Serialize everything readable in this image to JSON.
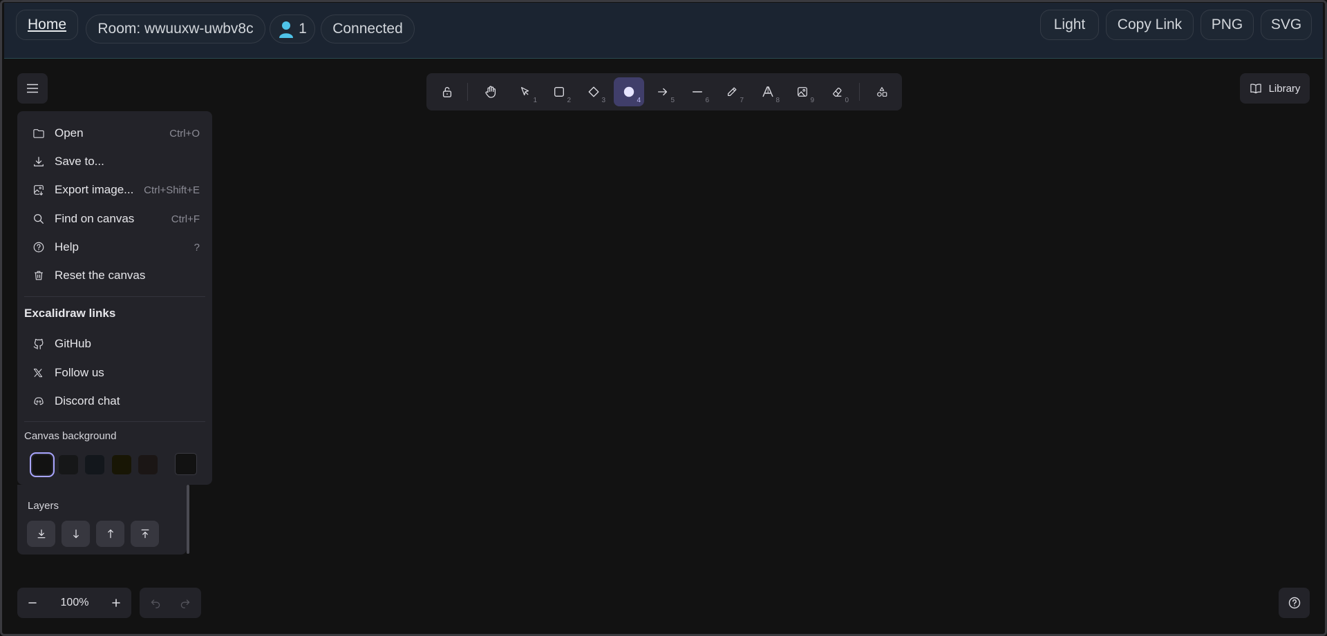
{
  "header": {
    "home_label": "Home",
    "room_label": "Room: wwuuxw-uwbv8c",
    "user_count": "1",
    "status": "Connected",
    "theme_button": "Light",
    "copy_link_button": "Copy Link",
    "png_button": "PNG",
    "svg_button": "SVG"
  },
  "toolbar": {
    "tools": [
      {
        "name": "lock",
        "key": ""
      },
      {
        "name": "hand",
        "key": ""
      },
      {
        "name": "selection",
        "key": "1"
      },
      {
        "name": "rectangle",
        "key": "2"
      },
      {
        "name": "diamond",
        "key": "3"
      },
      {
        "name": "ellipse",
        "key": "4"
      },
      {
        "name": "arrow",
        "key": "5"
      },
      {
        "name": "line",
        "key": "6"
      },
      {
        "name": "draw",
        "key": "7"
      },
      {
        "name": "text",
        "key": "8"
      },
      {
        "name": "image",
        "key": "9"
      },
      {
        "name": "eraser",
        "key": "0"
      },
      {
        "name": "extra-tools",
        "key": ""
      }
    ],
    "active_tool": "ellipse"
  },
  "library": {
    "label": "Library"
  },
  "menu": {
    "items": [
      {
        "label": "Open",
        "shortcut": "Ctrl+O",
        "icon": "folder-icon"
      },
      {
        "label": "Save to...",
        "shortcut": "",
        "icon": "download-icon"
      },
      {
        "label": "Export image...",
        "shortcut": "Ctrl+Shift+E",
        "icon": "export-image-icon"
      },
      {
        "label": "Find on canvas",
        "shortcut": "Ctrl+F",
        "icon": "search-icon"
      },
      {
        "label": "Help",
        "shortcut": "?",
        "icon": "help-icon"
      },
      {
        "label": "Reset the canvas",
        "shortcut": "",
        "icon": "trash-icon"
      }
    ],
    "links_heading": "Excalidraw links",
    "links": [
      {
        "label": "GitHub",
        "icon": "github-icon"
      },
      {
        "label": "Follow us",
        "icon": "x-icon"
      },
      {
        "label": "Discord chat",
        "icon": "discord-icon"
      }
    ],
    "canvas_background_label": "Canvas background",
    "background_colors": [
      "#121212",
      "#161718",
      "#13171c",
      "#181605",
      "#1b1615"
    ],
    "custom_background_color": "#121212"
  },
  "layers": {
    "label": "Layers"
  },
  "zoom": {
    "value": "100%"
  },
  "colors": {
    "accent": "#a8a5ff",
    "active_tool_bg": "#403e6a",
    "panel": "#232329",
    "canvas": "#121212"
  }
}
